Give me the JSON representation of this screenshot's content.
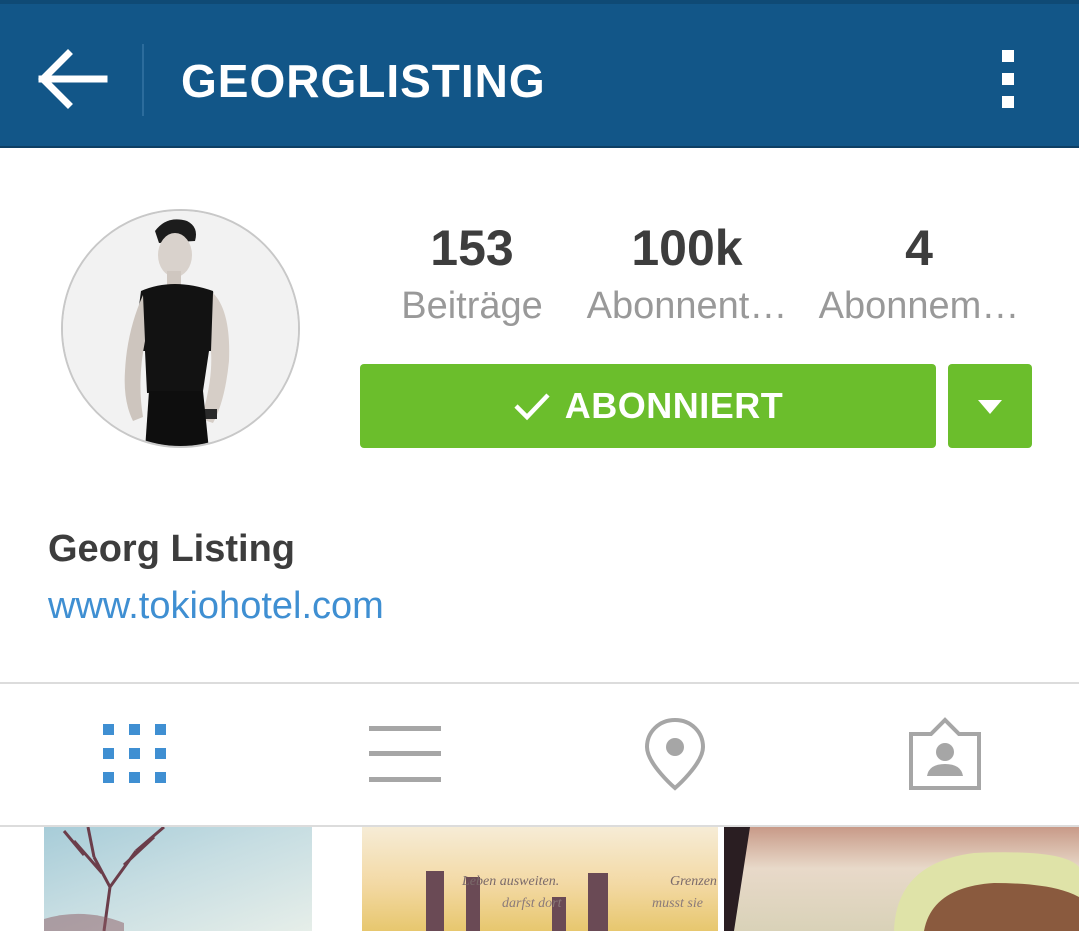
{
  "header": {
    "title": "GEORGLISTING",
    "back_icon": "arrow-left-icon",
    "menu_icon": "more-vertical-icon",
    "background_color": "#125688"
  },
  "profile": {
    "avatar_icon": "profile-photo",
    "stats": [
      {
        "value": "153",
        "label": "Beiträge"
      },
      {
        "value": "100k",
        "label": "Abonnent…"
      },
      {
        "value": "4",
        "label": "Abonnem…"
      }
    ],
    "follow_button": {
      "label": "ABONNIERT",
      "icon": "checkmark-icon",
      "color": "#6bbe2c"
    },
    "dropdown_icon": "triangle-down-icon",
    "name": "Georg Listing",
    "website": "www.tokiohotel.com"
  },
  "tabs": [
    {
      "icon": "grid-icon",
      "active": true
    },
    {
      "icon": "list-icon",
      "active": false
    },
    {
      "icon": "location-pin-icon",
      "active": false
    },
    {
      "icon": "tagged-person-icon",
      "active": false
    }
  ],
  "accent_color": "#3f8fd2",
  "photo_snippets": [
    "Leben ausweiten.",
    "Grenzen",
    "darfst dort",
    "musst sie"
  ]
}
